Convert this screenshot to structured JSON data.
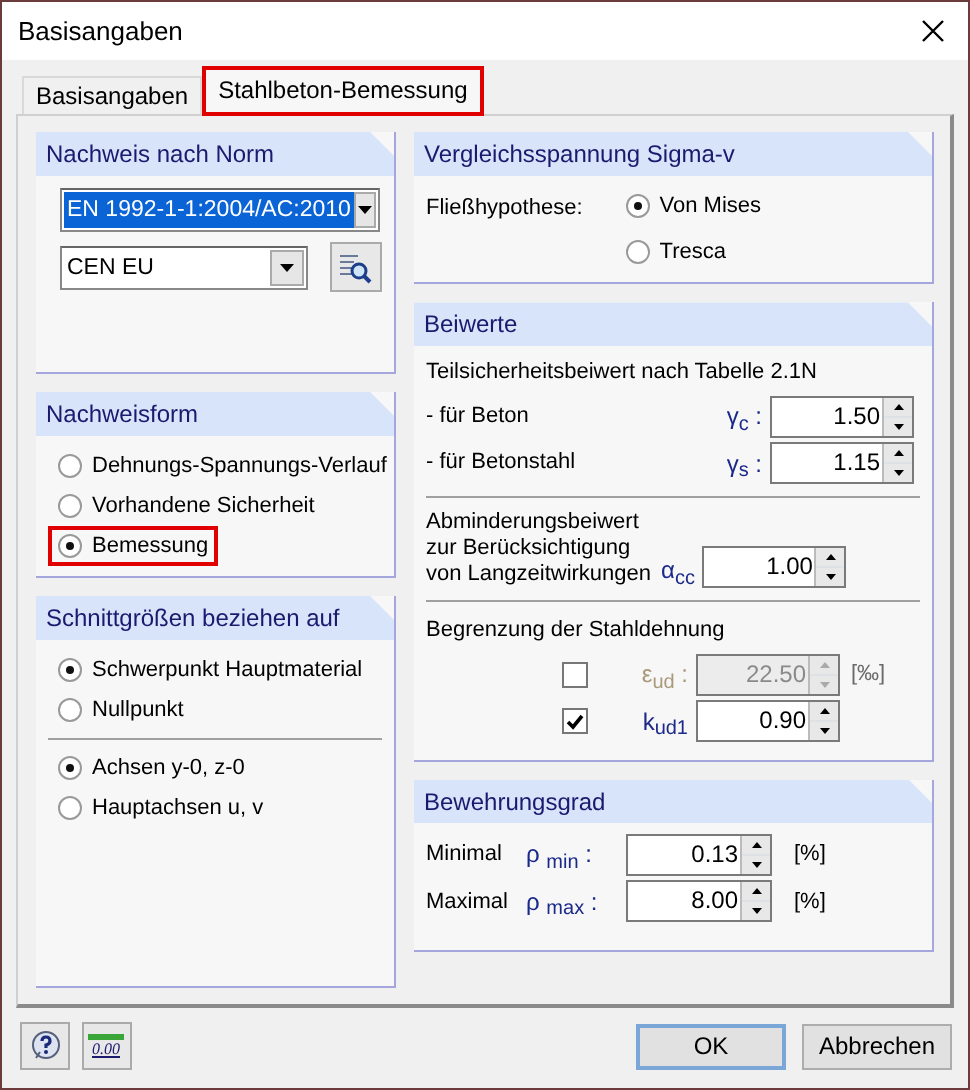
{
  "window": {
    "title": "Basisangaben"
  },
  "tabs": [
    {
      "label": "Basisangaben",
      "selected": false,
      "highlighted": false
    },
    {
      "label": "Stahlbeton-Bemessung",
      "selected": true,
      "highlighted": true
    }
  ],
  "left_groups": [
    {
      "kind": "norm",
      "title": "Nachweis nach Norm",
      "norm": {
        "value": "EN 1992-1-1:2004/AC:2010",
        "focused": true
      },
      "annex": {
        "value": "CEN EU",
        "focused": false
      }
    },
    {
      "kind": "radios",
      "title": "Nachweisform",
      "sections": [
        [
          {
            "label": "Dehnungs-Spannungs-Verlauf",
            "selected": false,
            "highlighted": false
          },
          {
            "label": "Vorhandene Sicherheit",
            "selected": false,
            "highlighted": false
          },
          {
            "label": "Bemessung",
            "selected": true,
            "highlighted": true
          }
        ]
      ]
    },
    {
      "kind": "radios",
      "title": "Schnittgrößen beziehen auf",
      "sections": [
        [
          {
            "label": "Schwerpunkt Hauptmaterial",
            "selected": true,
            "highlighted": false
          },
          {
            "label": "Nullpunkt",
            "selected": false,
            "highlighted": false
          }
        ],
        [
          {
            "label": "Achsen y-0, z-0",
            "selected": true,
            "highlighted": false
          },
          {
            "label": "Hauptachsen u, v",
            "selected": false,
            "highlighted": false
          }
        ]
      ]
    }
  ],
  "right_groups": [
    {
      "kind": "hypothesis",
      "title": "Vergleichsspannung Sigma-v",
      "label": "Fließhypothese:",
      "options": [
        {
          "label": "Von Mises",
          "selected": true
        },
        {
          "label": "Tresca",
          "selected": false
        }
      ]
    },
    {
      "kind": "factors",
      "title": "Beiwerte",
      "sections": [
        {
          "heading": "Teilsicherheitsbeiwert nach Tabelle 2.1N",
          "rows": [
            {
              "kind": "spin",
              "label": "- für Beton",
              "symbol": "γ$_{c}$ :",
              "value": "1.50"
            },
            {
              "kind": "spin",
              "label": "- für Betonstahl",
              "symbol": "γ$_{s}$ :",
              "value": "1.15"
            }
          ]
        },
        {
          "rows": [
            {
              "kind": "spin",
              "label": "Abminderungsbeiwert\nzur Berücksichtigung\nvon Langzeitwirkungen",
              "symbol": "α$_{cc}$",
              "value": "1.00"
            }
          ]
        },
        {
          "heading": "Begrenzung der Stahldehnung",
          "rows": [
            {
              "kind": "check",
              "checked": false,
              "disabled": true,
              "symbol": "ε$_{ud}$ :",
              "value": "22.50",
              "unit": "[‰]"
            },
            {
              "kind": "check",
              "checked": true,
              "disabled": false,
              "symbol": "k$_{ud1}$",
              "value": "0.90"
            }
          ]
        }
      ]
    },
    {
      "kind": "ratio",
      "title": "Bewehrungsgrad",
      "rows": [
        {
          "label": "Minimal",
          "symbol": "ρ $_{min}$ :",
          "value": "0.13",
          "unit": "[%]"
        },
        {
          "label": "Maximal",
          "symbol": "ρ $_{max}$ :",
          "value": "8.00",
          "unit": "[%]"
        }
      ]
    }
  ],
  "footer": {
    "units_button": {
      "label": "0.00"
    },
    "buttons": [
      "OK",
      "Abbrechen"
    ]
  }
}
